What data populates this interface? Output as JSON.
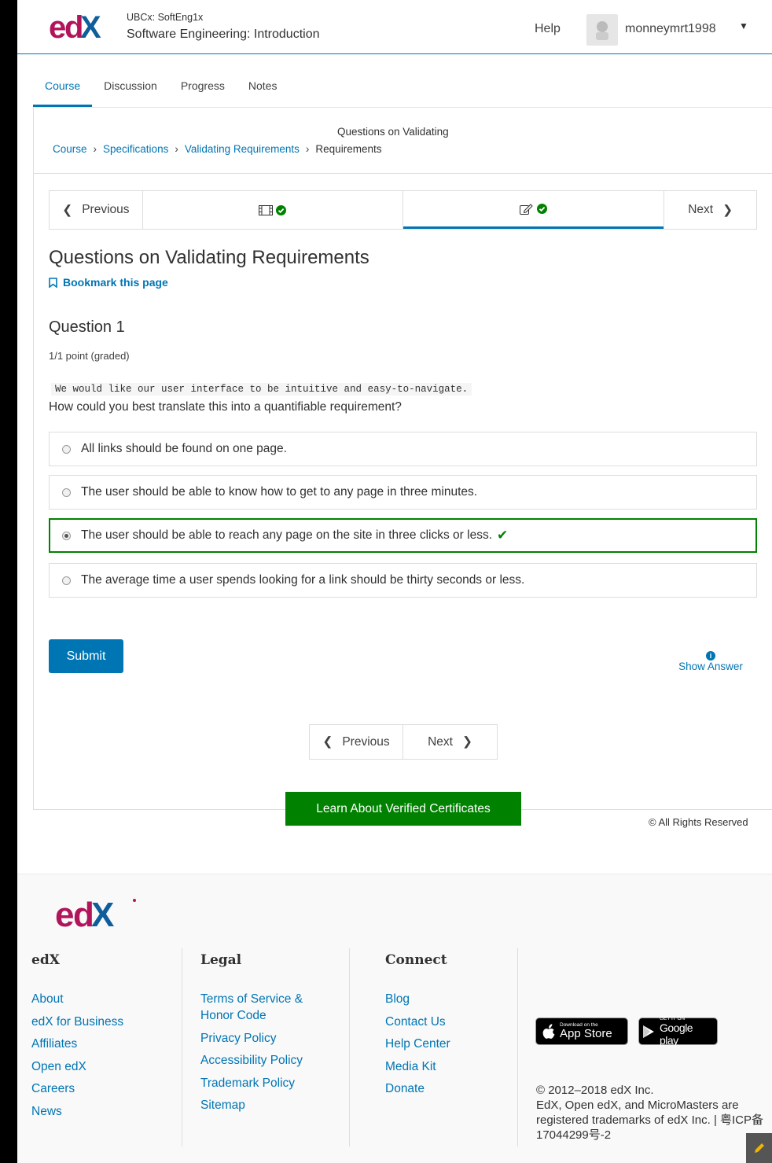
{
  "header": {
    "course_org": "UBCx: SoftEng1x",
    "course_title": "Software Engineering: Introduction",
    "help": "Help",
    "username": "monneymrt1998"
  },
  "tabs": [
    "Course",
    "Discussion",
    "Progress",
    "Notes"
  ],
  "breadcrumb": {
    "subtitle": "Questions on Validating",
    "items": [
      "Course",
      "Specifications",
      "Validating Requirements"
    ],
    "current": "Requirements"
  },
  "sequence_nav": {
    "previous": "Previous",
    "next": "Next"
  },
  "unit": {
    "title": "Questions on Validating Requirements",
    "bookmark": "Bookmark this page"
  },
  "problem": {
    "title": "Question 1",
    "score": "1/1 point (graded)",
    "code_text": "We would like our user interface to be intuitive and easy-to-navigate.",
    "prompt": "How could you best translate this into a quantifiable requirement?",
    "choices": [
      "All links should be found on one page.",
      "The user should be able to know how to get to any page in three minutes.",
      "The user should be able to reach any page on the site in three clicks or less.",
      "The average time a user spends looking for a link should be thirty seconds or less."
    ],
    "selected_index": 2,
    "submit": "Submit",
    "show_answer": "Show Answer"
  },
  "bottom_nav": {
    "previous": "Previous",
    "next": "Next"
  },
  "verified_button": "Learn About Verified Certificates",
  "rights": "© All Rights Reserved",
  "footer": {
    "col_edx": {
      "head": "edX",
      "links": [
        "About",
        "edX for Business",
        "Affiliates",
        "Open edX",
        "Careers",
        "News"
      ]
    },
    "col_legal": {
      "head": "Legal",
      "links": [
        "Terms of Service & Honor Code",
        "Privacy Policy",
        "Accessibility Policy",
        "Trademark Policy",
        "Sitemap"
      ]
    },
    "col_connect": {
      "head": "Connect",
      "links": [
        "Blog",
        "Contact Us",
        "Help Center",
        "Media Kit",
        "Donate"
      ]
    },
    "app_store": {
      "small": "Download on the",
      "big": "App Store"
    },
    "google_play": {
      "small": "GET IT ON",
      "big": "Google play"
    },
    "copyright": "© 2012–2018 edX Inc.",
    "trademark": "EdX, Open edX, and MicroMasters are registered trademarks of edX Inc. | 粤ICP备17044299号-2"
  },
  "colors": {
    "link": "#0075b4",
    "correct": "#008100",
    "edx_magenta": "#b1145a",
    "edx_blue": "#0f5e9c"
  }
}
